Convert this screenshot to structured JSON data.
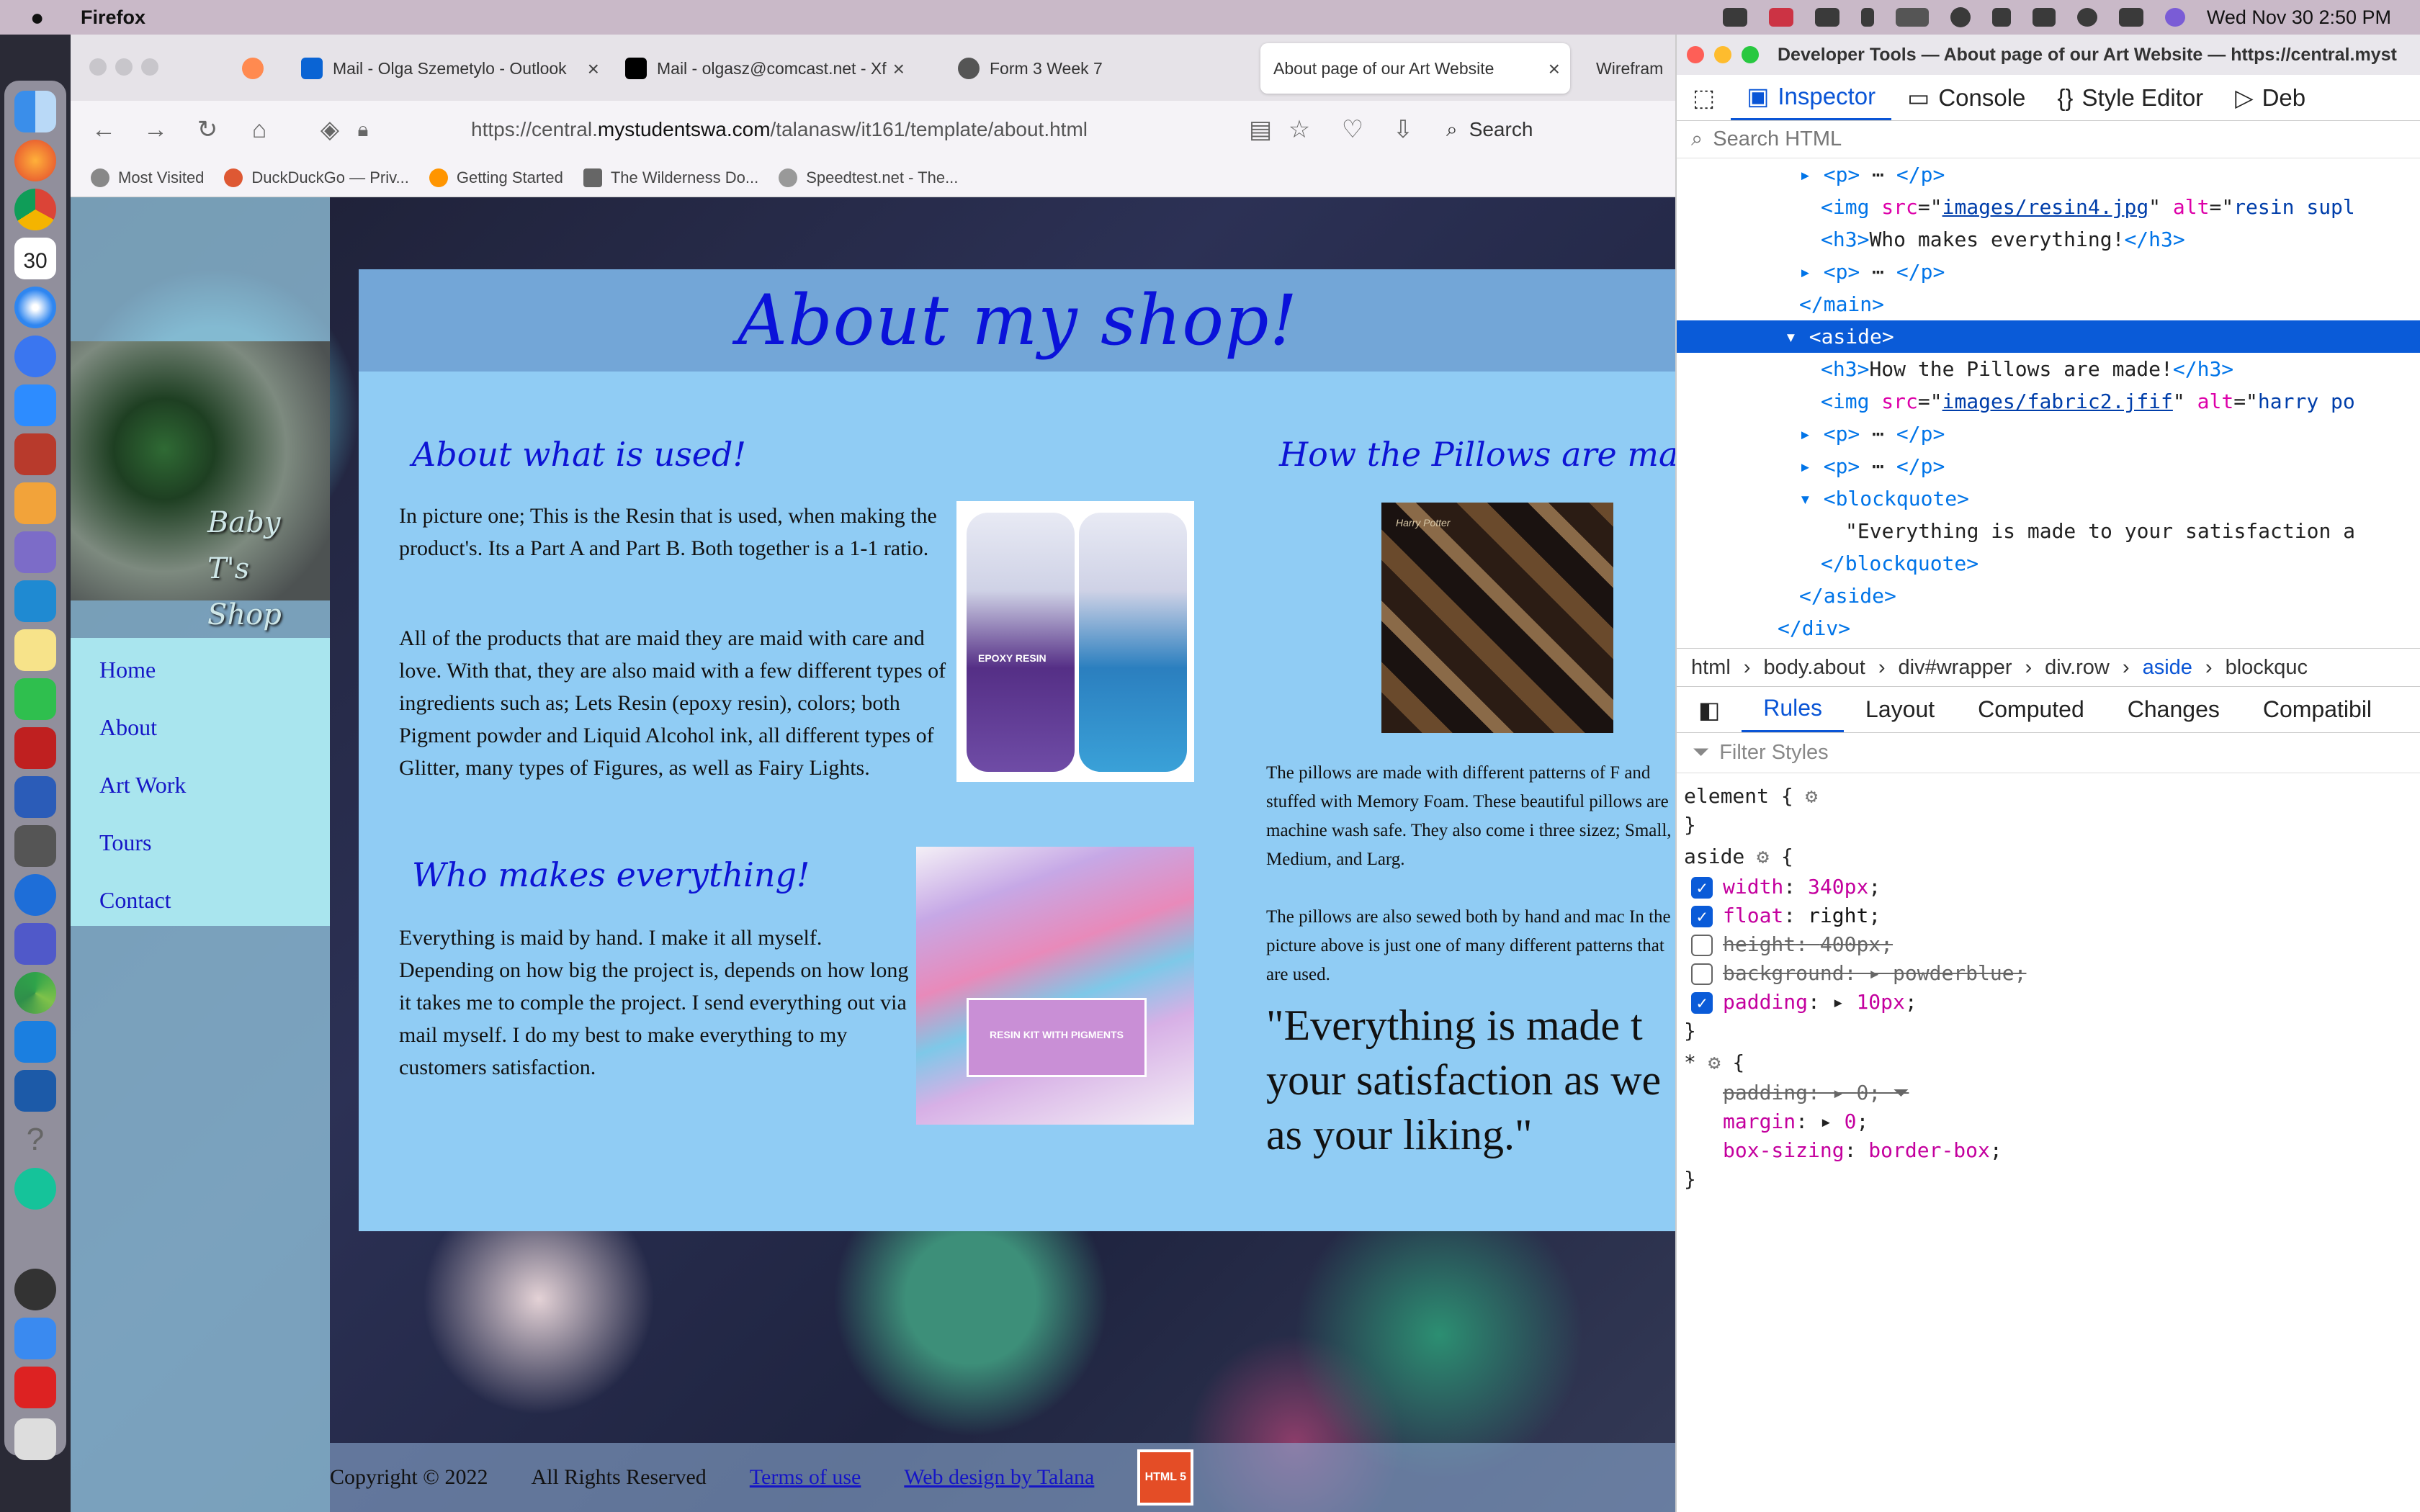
{
  "menubar": {
    "app_name": "Firefox",
    "datetime": "Wed Nov 30  2:50 PM"
  },
  "browser": {
    "tabs": [
      {
        "label": "",
        "icon_color": "#ff8a50"
      },
      {
        "label": "Mail - Olga Szemetylo - Outlook",
        "icon_color": "#0a64d4"
      },
      {
        "label": "Mail - olgasz@comcast.net - Xf",
        "icon_color": "#000000"
      },
      {
        "label": "Form 3 Week 7",
        "icon_color": "#555555"
      },
      {
        "label": "About page of our Art Website",
        "icon_color": "#ffffff"
      },
      {
        "label": "Wirefram",
        "icon_color": "#ffffff"
      }
    ],
    "url_prefix": "https://central.",
    "url_host": "mystudentswa.com",
    "url_path": "/talanasw/it161/template/about.html",
    "search_placeholder": "Search",
    "bookmarks": [
      {
        "label": "Most Visited",
        "icon_color": "#888888"
      },
      {
        "label": "DuckDuckGo — Priv...",
        "icon_color": "#de5833"
      },
      {
        "label": "Getting Started",
        "icon_color": "#ff9500"
      },
      {
        "label": "The Wilderness Do...",
        "icon_color": "#666666"
      },
      {
        "label": "Speedtest.net - The...",
        "icon_color": "#999999"
      }
    ]
  },
  "site": {
    "logo_line1": "Baby T's",
    "logo_line2": "Shop",
    "nav": [
      "Home",
      "About",
      "Art Work",
      "Tours",
      "Contact"
    ],
    "page_title": "About my shop!",
    "main": {
      "heading1": "About what is used!",
      "para1": "In picture one; This is the Resin that is used, when making the product's. Its a Part A and Part B. Both together is a 1-1 ratio.",
      "para2": "All of the products that are maid they are maid with care and love. With that, they are also maid with a few different types of ingredients such as; Lets Resin (epoxy resin), colors; both Pigment powder and Liquid Alcohol ink, all different types of Glitter, many types of Figures, as well as Fairy Lights.",
      "image1_label": "EPOXY RESIN",
      "heading2": "Who makes everything!",
      "para3": "Everything is maid by hand. I make it all myself. Depending on how big the project is, depends on how long it takes me to comple the project. I send everything out via mail myself. I do my best to make everything to my customers satisfaction.",
      "image2_label": "RESIN KIT WITH PIGMENTS"
    },
    "aside": {
      "heading": "How the Pillows are ma",
      "image_label": "Harry Potter",
      "para1": "The pillows are made with different patterns of F and stuffed with Memory Foam. These beautiful pillows are machine wash safe. They also come i three sizez; Small, Medium, and Larg.",
      "para2": "The pillows are also sewed both by hand and mac In the picture above is just one of many different patterns that are used.",
      "quote": "\"Everything is made t your satisfaction as we as your liking.\""
    },
    "footer": {
      "copyright": "Copyright © 2022",
      "rights": "All Rights Reserved",
      "terms": "Terms of use",
      "design": "Web design by Talana",
      "badge": "HTML 5"
    }
  },
  "devtools": {
    "title": "Developer Tools — About page of our Art Website — https://central.myst",
    "tabs": [
      "Inspector",
      "Console",
      "Style Editor",
      "Deb"
    ],
    "search_placeholder": "Search HTML",
    "breadcrumb": [
      "html",
      "body.about",
      "div#wrapper",
      "div.row",
      "aside",
      "blockquc"
    ],
    "rules_tabs": [
      "Rules",
      "Layout",
      "Computed",
      "Changes",
      "Compatibil"
    ],
    "filter_placeholder": "Filter Styles",
    "dom": {
      "img1_src": "images/resin4.jpg",
      "img1_alt": "resin supl",
      "h3_main": "Who makes everything!",
      "h3_aside": "How the Pillows are made!",
      "img2_src": "images/fabric2.jfif",
      "img2_alt": "harry po",
      "quote_text": "\"Everything is made to your satisfaction a"
    },
    "rules": {
      "element_selector": "element {",
      "aside_selector": "aside",
      "aside_props": [
        {
          "name": "width",
          "value": "340px",
          "enabled": true
        },
        {
          "name": "float",
          "value": "right",
          "enabled": true
        },
        {
          "name": "height",
          "value": "400px",
          "enabled": false
        },
        {
          "name": "background",
          "value": "powderblue",
          "enabled": false
        },
        {
          "name": "padding",
          "value": "10px",
          "enabled": true
        }
      ],
      "star_selector": "*",
      "star_props": [
        {
          "name": "padding",
          "value": "0",
          "overridden": true
        },
        {
          "name": "margin",
          "value": "0",
          "overridden": false
        },
        {
          "name": "box-sizing",
          "value": "border-box",
          "overridden": false
        }
      ]
    }
  }
}
